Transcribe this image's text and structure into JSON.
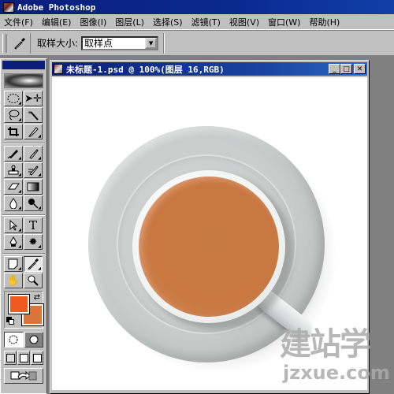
{
  "app": {
    "title": "Adobe Photoshop",
    "icon": "photoshop-eye-icon"
  },
  "menubar": {
    "items": [
      {
        "label": "文件(F)"
      },
      {
        "label": "编辑(E)"
      },
      {
        "label": "图像(I)"
      },
      {
        "label": "图层(L)"
      },
      {
        "label": "选择(S)"
      },
      {
        "label": "滤镜(T)"
      },
      {
        "label": "视图(V)"
      },
      {
        "label": "窗口(W)"
      },
      {
        "label": "帮助(H)"
      }
    ]
  },
  "options_bar": {
    "current_tool_icon": "eyedropper-icon",
    "sample_size_label": "取样大小:",
    "sample_size_value": "取样点"
  },
  "toolbox": {
    "tools": [
      {
        "name": "marquee-tool",
        "glyph": "◌"
      },
      {
        "name": "move-tool",
        "glyph": "➤"
      },
      {
        "name": "lasso-tool",
        "glyph": "ᘓ"
      },
      {
        "name": "magic-wand-tool",
        "glyph": "⟋"
      },
      {
        "name": "crop-tool",
        "glyph": "⌗"
      },
      {
        "name": "slice-tool",
        "glyph": "✎"
      },
      {
        "name": "healing-brush-tool",
        "glyph": "✐"
      },
      {
        "name": "brush-tool",
        "glyph": "✎"
      },
      {
        "name": "clone-stamp-tool",
        "glyph": "♙"
      },
      {
        "name": "history-brush-tool",
        "glyph": "✑"
      },
      {
        "name": "eraser-tool",
        "glyph": "▱"
      },
      {
        "name": "gradient-tool",
        "glyph": "▬"
      },
      {
        "name": "blur-tool",
        "glyph": "💧"
      },
      {
        "name": "dodge-tool",
        "glyph": "⚲"
      },
      {
        "name": "path-selection-tool",
        "glyph": "↖"
      },
      {
        "name": "type-tool",
        "glyph": "T"
      },
      {
        "name": "pen-tool",
        "glyph": "✒"
      },
      {
        "name": "custom-shape-tool",
        "glyph": "✹"
      },
      {
        "name": "notes-tool",
        "glyph": "▢"
      },
      {
        "name": "eyedropper-tool",
        "glyph": "✎"
      },
      {
        "name": "hand-tool",
        "glyph": "✋"
      },
      {
        "name": "zoom-tool",
        "glyph": "⚲"
      }
    ],
    "active_tool": "eyedropper-tool",
    "foreground_color": "#f05a20",
    "background_color": "#d6763a",
    "swap_glyph": "⇄"
  },
  "document": {
    "title": "未标题-1.psd @ 100%(图层 16,RGB)",
    "minimize": "_",
    "maximize": "□",
    "close": "✕",
    "image_description": "Top view of a white tea cup with milk tea on a gray saucer",
    "tea_color": "#c87a44",
    "saucer_color": "#c8cccb"
  },
  "watermark": {
    "cn": "建站学",
    "en": "jzxue.com"
  }
}
